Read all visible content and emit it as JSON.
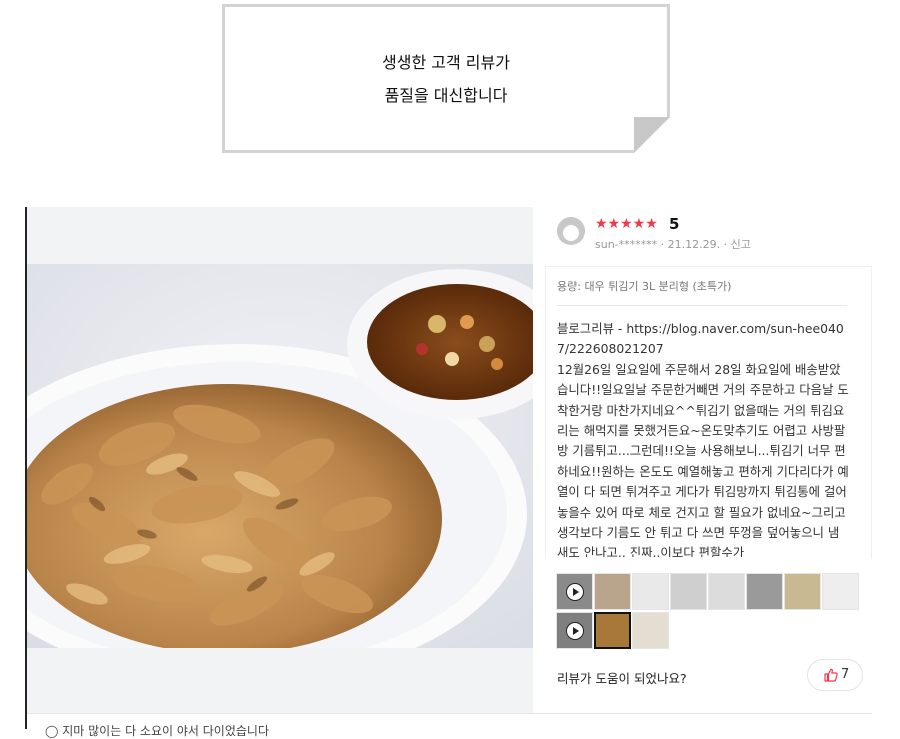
{
  "banner": {
    "line1": "생생한 고객 리뷰가",
    "line2": "품질을 대신합니다"
  },
  "review": {
    "stars": "★★★★★",
    "rating": "5",
    "user": "sun-*******",
    "date": "21.12.29.",
    "report_label": "신고",
    "option": "용량: 대우 튀김기 3L 분리형 (초특가)",
    "body": "블로그리뷰 - https://blog.naver.com/sun-hee0407/222608021207\n12월26일 일요일에 주문해서 28일 화요일에 배송받았습니다!!일요일날 주문한거빼면 거의 주문하고 다음날 도착한거랑 마찬가지네요^^튀김기 없을때는 거의 튀김요리는 해먹지를 못했거든요~온도맞추기도 어렵고 사방팔방 기름튀고...그런데!!오늘 사용해보니...튀김기 너무 편하네요!!원하는 온도도 예열해놓고 편하게 기다리다가 예열이 다 되면 튀겨주고 게다가 튀김망까지 튀김통에 걸어놓을수 있어 따로 체로 건지고 할 필요가 없네요~그리고 생각보다 기름도 안 튀고 다 쓰면 뚜껑을 덮어놓으니 냄새도 안나고.. 진짜..이보다 편할수가",
    "helpful_question": "리뷰가 도움이 되었나요?",
    "like_count": "7"
  },
  "footer": {
    "text": "◯ 지마 많이는 다 소요이 야서 다이었습니다"
  },
  "thumbnails": [
    {
      "kind": "video",
      "color": "#8a8a8a"
    },
    {
      "kind": "image",
      "color": "#b8a58c"
    },
    {
      "kind": "image",
      "color": "#e9e9e9"
    },
    {
      "kind": "image",
      "color": "#cfcfcf"
    },
    {
      "kind": "image",
      "color": "#dcdcdc"
    },
    {
      "kind": "image",
      "color": "#9a9a9a"
    },
    {
      "kind": "image",
      "color": "#c9b991"
    },
    {
      "kind": "image",
      "color": "#eeeeee"
    },
    {
      "kind": "video",
      "color": "#7f7f7f"
    },
    {
      "kind": "image",
      "color": "#a8773a",
      "selected": true
    },
    {
      "kind": "image",
      "color": "#e4ddd2"
    }
  ],
  "colors": {
    "star": "#f2384b",
    "like_icon": "#f2384b",
    "photo_bg": "#f2f3f5"
  }
}
